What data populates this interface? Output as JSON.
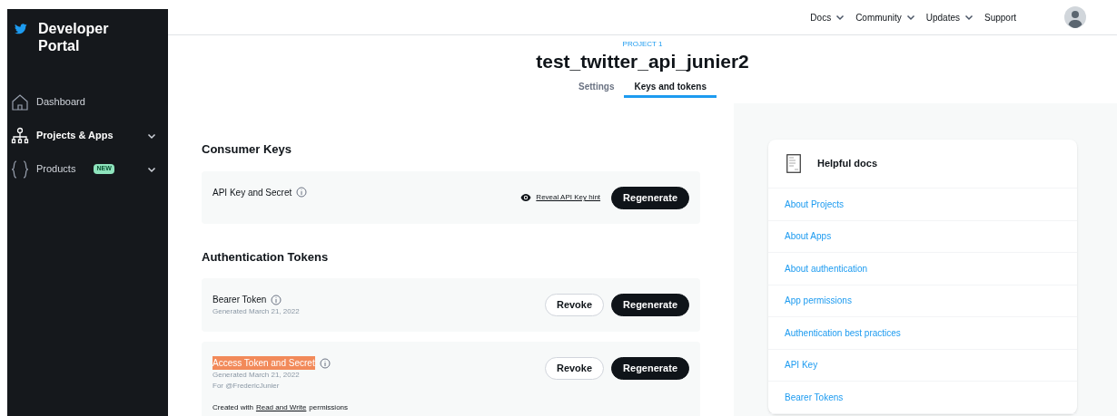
{
  "sidebar": {
    "brand": "Developer Portal",
    "items": [
      {
        "kind": "home",
        "label": "Dashboard",
        "selected": false,
        "expandable": false
      },
      {
        "kind": "projects",
        "label": "Projects & Apps",
        "selected": true,
        "expandable": true
      },
      {
        "kind": "products",
        "label": "Products",
        "selected": false,
        "expandable": true,
        "badge": "NEW"
      }
    ]
  },
  "top_nav": [
    {
      "label": "Docs",
      "dropdown": true
    },
    {
      "label": "Community",
      "dropdown": true
    },
    {
      "label": "Updates",
      "dropdown": true
    },
    {
      "label": "Support",
      "dropdown": false
    }
  ],
  "header": {
    "eyebrow": "PROJECT 1",
    "title": "test_twitter_api_junier2",
    "tabs": [
      {
        "label": "Settings",
        "selected": false
      },
      {
        "label": "Keys and tokens",
        "selected": true
      }
    ]
  },
  "sections": [
    {
      "title": "Consumer Keys",
      "cards": [
        {
          "name": "API Key and Secret",
          "highlighted": false,
          "hint_link": "Reveal API Key hint",
          "buttons": [
            {
              "label": "Regenerate",
              "kind": "primary"
            }
          ]
        }
      ]
    },
    {
      "title": "Authentication Tokens",
      "cards": [
        {
          "name": "Bearer Token",
          "highlighted": false,
          "details": [
            "Generated March 21, 2022"
          ],
          "buttons": [
            {
              "label": "Revoke",
              "kind": "secondary"
            },
            {
              "label": "Regenerate",
              "kind": "primary"
            }
          ]
        },
        {
          "name": "Access Token and Secret",
          "highlighted": true,
          "details": [
            "Generated March 21, 2022",
            "For @FredericJunier"
          ],
          "note": {
            "before": "Created with",
            "link": "Read and Write",
            "after": "permissions"
          },
          "buttons": [
            {
              "label": "Revoke",
              "kind": "secondary"
            },
            {
              "label": "Regenerate",
              "kind": "primary"
            }
          ]
        }
      ]
    }
  ],
  "helpful_docs": {
    "title": "Helpful docs",
    "links": [
      "About Projects",
      "About Apps",
      "About authentication",
      "App permissions",
      "Authentication best practices",
      "API Key",
      "Bearer Tokens"
    ]
  }
}
